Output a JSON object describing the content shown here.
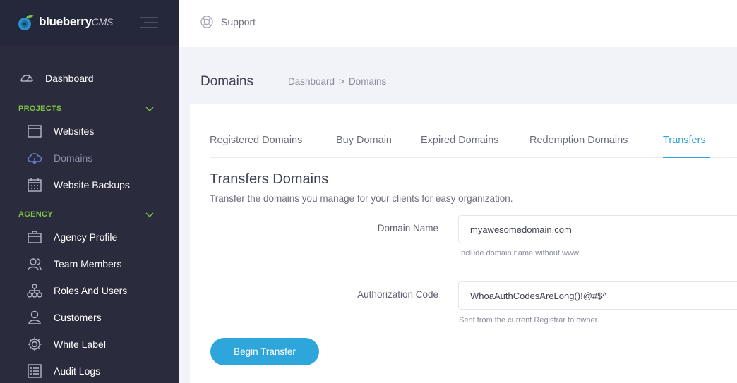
{
  "brand": {
    "name": "blueberry",
    "suffix": "CMS"
  },
  "topbar": {
    "support_label": "Support"
  },
  "sidebar": {
    "dashboard_label": "Dashboard",
    "projects_heading": "PROJECTS",
    "projects_items": [
      {
        "label": "Websites",
        "icon": "browser-window-icon"
      },
      {
        "label": "Domains",
        "icon": "cloud-icon"
      },
      {
        "label": "Website Backups",
        "icon": "calendar-icon"
      }
    ],
    "agency_heading": "AGENCY",
    "agency_items": [
      {
        "label": "Agency Profile",
        "icon": "briefcase-icon"
      },
      {
        "label": "Team Members",
        "icon": "team-icon"
      },
      {
        "label": "Roles And Users",
        "icon": "hierarchy-icon"
      },
      {
        "label": "Customers",
        "icon": "user-icon"
      },
      {
        "label": "White Label",
        "icon": "gear-icon"
      },
      {
        "label": "Audit Logs",
        "icon": "list-icon"
      }
    ],
    "active_item": "Domains"
  },
  "subheader": {
    "title": "Domains",
    "breadcrumb": [
      "Dashboard",
      "Domains"
    ],
    "breadcrumb_separator": ">"
  },
  "tabs": [
    {
      "label": "Registered Domains",
      "active": false
    },
    {
      "label": "Buy Domain",
      "active": false
    },
    {
      "label": "Expired Domains",
      "active": false
    },
    {
      "label": "Redemption Domains",
      "active": false
    },
    {
      "label": "Transfers",
      "active": true
    }
  ],
  "section": {
    "title": "Transfers Domains",
    "description": "Transfer the domains you manage for your clients for easy organization."
  },
  "form": {
    "domain_name": {
      "label": "Domain Name",
      "value": "myawesomedomain.com",
      "hint": "Include domain name without www"
    },
    "auth_code": {
      "label": "Authorization Code",
      "value": "WhoaAuthCodesAreLong()!@#$^",
      "hint": "Sent from the current Registrar to owner."
    },
    "submit_label": "Begin Transfer"
  },
  "colors": {
    "sidebar_bg": "#2a2c3d",
    "accent": "#2ea6dc",
    "section_heading": "#7fc242",
    "page_bg": "#f2f3f8"
  }
}
